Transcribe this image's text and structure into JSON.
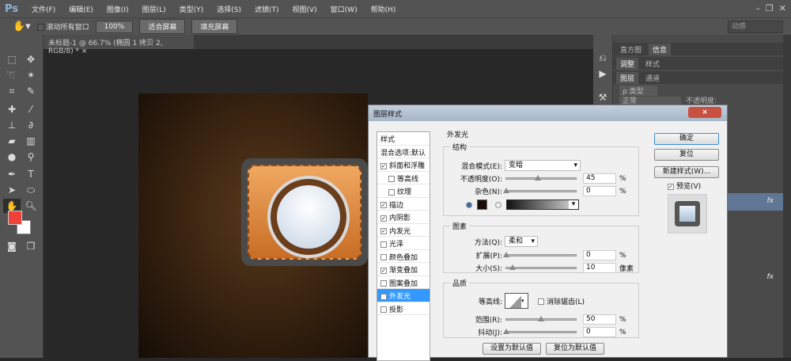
{
  "app": {
    "logo": "Ps",
    "menus": [
      "文件(F)",
      "编辑(E)",
      "图像(I)",
      "图层(L)",
      "类型(Y)",
      "选择(S)",
      "滤镜(T)",
      "视图(V)",
      "窗口(W)",
      "帮助(H)"
    ]
  },
  "options": {
    "scroll_all": "滚动所有窗口",
    "zoom100": "100%",
    "fit": "适合屏幕",
    "fill": "填充屏幕",
    "workspace": "动感"
  },
  "document": {
    "tab": "未标题-1 @ 66.7% (椭圆 1 拷贝 2, RGB/8) *",
    "close": "×"
  },
  "colors": {
    "foreground": "#f0403a",
    "background": "#ffffff"
  },
  "panels": {
    "tabs1": [
      "直方图",
      "信息"
    ],
    "tabs2": [
      "调整",
      "样式"
    ],
    "tabs3": [
      "图层",
      "通道"
    ],
    "filter": "ρ 类型",
    "blend": "正常",
    "opacity_label": "不透明度:",
    "fx": "fx"
  },
  "dialog": {
    "title": "图层样式",
    "close": "×",
    "styles_header": "样式",
    "blend_default": "混合选项:默认",
    "styles": [
      {
        "label": "斜面和浮雕",
        "checked": true,
        "sub": false
      },
      {
        "label": "等高线",
        "checked": false,
        "sub": true
      },
      {
        "label": "纹理",
        "checked": false,
        "sub": true
      },
      {
        "label": "描边",
        "checked": true,
        "sub": false
      },
      {
        "label": "内阴影",
        "checked": true,
        "sub": false
      },
      {
        "label": "内发光",
        "checked": true,
        "sub": false
      },
      {
        "label": "光泽",
        "checked": false,
        "sub": false
      },
      {
        "label": "颜色叠加",
        "checked": false,
        "sub": false
      },
      {
        "label": "渐变叠加",
        "checked": true,
        "sub": false
      },
      {
        "label": "图案叠加",
        "checked": false,
        "sub": false
      },
      {
        "label": "外发光",
        "checked": true,
        "sub": false,
        "selected": true
      },
      {
        "label": "投影",
        "checked": false,
        "sub": false
      }
    ],
    "section": "外发光",
    "structure": {
      "title": "结构",
      "blend_mode_label": "混合模式(E):",
      "blend_mode": "变暗",
      "opacity_label": "不透明度(O):",
      "opacity": "45",
      "noise_label": "杂色(N):",
      "noise": "0",
      "pct": "%",
      "glow_color": "#1a0d08"
    },
    "elements": {
      "title": "图素",
      "technique_label": "方法(Q):",
      "technique": "柔和",
      "spread_label": "扩展(P):",
      "spread": "0",
      "size_label": "大小(S):",
      "size": "10",
      "px": "像素"
    },
    "quality": {
      "title": "品质",
      "contour_label": "等高线:",
      "antialias": "消除锯齿(L)",
      "range_label": "范围(R):",
      "range": "50",
      "jitter_label": "抖动(J):",
      "jitter": "0"
    },
    "make_default": "设置为默认值",
    "reset_default": "复位为默认值",
    "ok": "确定",
    "reset": "复位",
    "new_style": "新建样式(W)...",
    "preview": "预览(V)"
  }
}
